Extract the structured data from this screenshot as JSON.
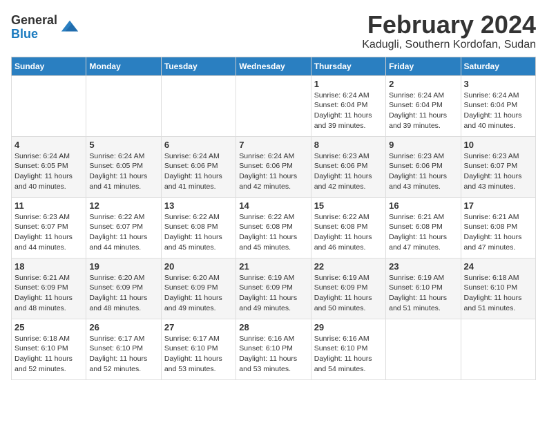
{
  "logo": {
    "general": "General",
    "blue": "Blue"
  },
  "title": "February 2024",
  "subtitle": "Kadugli, Southern Kordofan, Sudan",
  "days_of_week": [
    "Sunday",
    "Monday",
    "Tuesday",
    "Wednesday",
    "Thursday",
    "Friday",
    "Saturday"
  ],
  "weeks": [
    [
      {
        "num": "",
        "info": ""
      },
      {
        "num": "",
        "info": ""
      },
      {
        "num": "",
        "info": ""
      },
      {
        "num": "",
        "info": ""
      },
      {
        "num": "1",
        "info": "Sunrise: 6:24 AM\nSunset: 6:04 PM\nDaylight: 11 hours\nand 39 minutes."
      },
      {
        "num": "2",
        "info": "Sunrise: 6:24 AM\nSunset: 6:04 PM\nDaylight: 11 hours\nand 39 minutes."
      },
      {
        "num": "3",
        "info": "Sunrise: 6:24 AM\nSunset: 6:04 PM\nDaylight: 11 hours\nand 40 minutes."
      }
    ],
    [
      {
        "num": "4",
        "info": "Sunrise: 6:24 AM\nSunset: 6:05 PM\nDaylight: 11 hours\nand 40 minutes."
      },
      {
        "num": "5",
        "info": "Sunrise: 6:24 AM\nSunset: 6:05 PM\nDaylight: 11 hours\nand 41 minutes."
      },
      {
        "num": "6",
        "info": "Sunrise: 6:24 AM\nSunset: 6:06 PM\nDaylight: 11 hours\nand 41 minutes."
      },
      {
        "num": "7",
        "info": "Sunrise: 6:24 AM\nSunset: 6:06 PM\nDaylight: 11 hours\nand 42 minutes."
      },
      {
        "num": "8",
        "info": "Sunrise: 6:23 AM\nSunset: 6:06 PM\nDaylight: 11 hours\nand 42 minutes."
      },
      {
        "num": "9",
        "info": "Sunrise: 6:23 AM\nSunset: 6:06 PM\nDaylight: 11 hours\nand 43 minutes."
      },
      {
        "num": "10",
        "info": "Sunrise: 6:23 AM\nSunset: 6:07 PM\nDaylight: 11 hours\nand 43 minutes."
      }
    ],
    [
      {
        "num": "11",
        "info": "Sunrise: 6:23 AM\nSunset: 6:07 PM\nDaylight: 11 hours\nand 44 minutes."
      },
      {
        "num": "12",
        "info": "Sunrise: 6:22 AM\nSunset: 6:07 PM\nDaylight: 11 hours\nand 44 minutes."
      },
      {
        "num": "13",
        "info": "Sunrise: 6:22 AM\nSunset: 6:08 PM\nDaylight: 11 hours\nand 45 minutes."
      },
      {
        "num": "14",
        "info": "Sunrise: 6:22 AM\nSunset: 6:08 PM\nDaylight: 11 hours\nand 45 minutes."
      },
      {
        "num": "15",
        "info": "Sunrise: 6:22 AM\nSunset: 6:08 PM\nDaylight: 11 hours\nand 46 minutes."
      },
      {
        "num": "16",
        "info": "Sunrise: 6:21 AM\nSunset: 6:08 PM\nDaylight: 11 hours\nand 47 minutes."
      },
      {
        "num": "17",
        "info": "Sunrise: 6:21 AM\nSunset: 6:08 PM\nDaylight: 11 hours\nand 47 minutes."
      }
    ],
    [
      {
        "num": "18",
        "info": "Sunrise: 6:21 AM\nSunset: 6:09 PM\nDaylight: 11 hours\nand 48 minutes."
      },
      {
        "num": "19",
        "info": "Sunrise: 6:20 AM\nSunset: 6:09 PM\nDaylight: 11 hours\nand 48 minutes."
      },
      {
        "num": "20",
        "info": "Sunrise: 6:20 AM\nSunset: 6:09 PM\nDaylight: 11 hours\nand 49 minutes."
      },
      {
        "num": "21",
        "info": "Sunrise: 6:19 AM\nSunset: 6:09 PM\nDaylight: 11 hours\nand 49 minutes."
      },
      {
        "num": "22",
        "info": "Sunrise: 6:19 AM\nSunset: 6:09 PM\nDaylight: 11 hours\nand 50 minutes."
      },
      {
        "num": "23",
        "info": "Sunrise: 6:19 AM\nSunset: 6:10 PM\nDaylight: 11 hours\nand 51 minutes."
      },
      {
        "num": "24",
        "info": "Sunrise: 6:18 AM\nSunset: 6:10 PM\nDaylight: 11 hours\nand 51 minutes."
      }
    ],
    [
      {
        "num": "25",
        "info": "Sunrise: 6:18 AM\nSunset: 6:10 PM\nDaylight: 11 hours\nand 52 minutes."
      },
      {
        "num": "26",
        "info": "Sunrise: 6:17 AM\nSunset: 6:10 PM\nDaylight: 11 hours\nand 52 minutes."
      },
      {
        "num": "27",
        "info": "Sunrise: 6:17 AM\nSunset: 6:10 PM\nDaylight: 11 hours\nand 53 minutes."
      },
      {
        "num": "28",
        "info": "Sunrise: 6:16 AM\nSunset: 6:10 PM\nDaylight: 11 hours\nand 53 minutes."
      },
      {
        "num": "29",
        "info": "Sunrise: 6:16 AM\nSunset: 6:10 PM\nDaylight: 11 hours\nand 54 minutes."
      },
      {
        "num": "",
        "info": ""
      },
      {
        "num": "",
        "info": ""
      }
    ]
  ]
}
